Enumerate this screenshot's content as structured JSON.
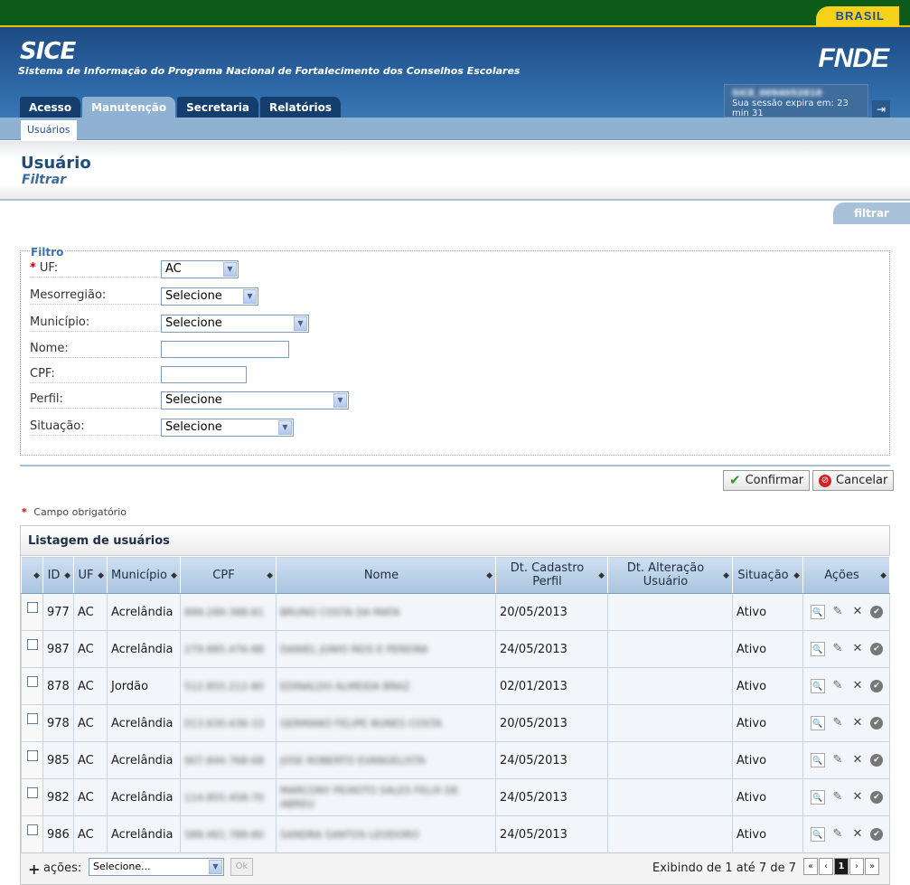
{
  "brasil_badge": "BRASIL",
  "app": {
    "title": "SICE",
    "subtitle": "Sistema de Informação do Programa Nacional de Fortalecimento dos Conselhos Escolares",
    "logo": "FNDE"
  },
  "session": {
    "user": "SICE_0094052816",
    "expires": "Sua sessão expira em: 23 min 31"
  },
  "tabs": [
    "Acesso",
    "Manutenção",
    "Secretaria",
    "Relatórios"
  ],
  "subtab": "Usuários",
  "page": {
    "title": "Usuário",
    "subtitle": "Filtrar",
    "filter_tab": "filtrar"
  },
  "filter": {
    "legend": "Filtro",
    "required_mark": "*",
    "uf_label": "UF:",
    "uf_value": "AC",
    "meso_label": "Mesorregião:",
    "meso_value": "Selecione",
    "mun_label": "Município:",
    "mun_value": "Selecione",
    "nome_label": "Nome:",
    "cpf_label": "CPF:",
    "perfil_label": "Perfil:",
    "perfil_value": "Selecione",
    "sit_label": "Situação:",
    "sit_value": "Selecione"
  },
  "buttons": {
    "confirm": "Confirmar",
    "cancel": "Cancelar"
  },
  "required_note": "Campo obrigatório",
  "list": {
    "title": "Listagem de usuários",
    "columns": [
      "",
      "ID",
      "UF",
      "Município",
      "CPF",
      "Nome",
      "Dt. Cadastro Perfil",
      "Dt. Alteração Usuário",
      "Situação",
      "Ações"
    ],
    "rows": [
      {
        "id": "977",
        "uf": "AC",
        "mun": "Acrelândia",
        "cpf": "899.289.388-81",
        "nome": "BRUNO COSTA DA MATA",
        "cad": "20/05/2013",
        "alt": "",
        "sit": "Ativo"
      },
      {
        "id": "987",
        "uf": "AC",
        "mun": "Acrelândia",
        "cpf": "279.885.476-88",
        "nome": "DANIEL JUNIO REIS E PEREIRA",
        "cad": "24/05/2013",
        "alt": "",
        "sit": "Ativo"
      },
      {
        "id": "878",
        "uf": "AC",
        "mun": "Jordão",
        "cpf": "512.855.212-80",
        "nome": "EDINALDO ALMEIDA BRAZ",
        "cad": "02/01/2013",
        "alt": "",
        "sit": "Ativo"
      },
      {
        "id": "978",
        "uf": "AC",
        "mun": "Acrelândia",
        "cpf": "013.630.436-33",
        "nome": "GERMANO FELIPE NUNES COSTA",
        "cad": "20/05/2013",
        "alt": "",
        "sit": "Ativo"
      },
      {
        "id": "985",
        "uf": "AC",
        "mun": "Acrelândia",
        "cpf": "907.844.768-68",
        "nome": "JOSE ROBERTO EVANGELISTA",
        "cad": "24/05/2013",
        "alt": "",
        "sit": "Ativo"
      },
      {
        "id": "982",
        "uf": "AC",
        "mun": "Acrelândia",
        "cpf": "114.855.458-70",
        "nome": "MARCONY PEIXOTO SALES FELIX DE ABREU",
        "cad": "24/05/2013",
        "alt": "",
        "sit": "Ativo"
      },
      {
        "id": "986",
        "uf": "AC",
        "mun": "Acrelândia",
        "cpf": "589.461.788-80",
        "nome": "SANDRA SANTOS LEODORO",
        "cad": "24/05/2013",
        "alt": "",
        "sit": "Ativo"
      }
    ]
  },
  "footer": {
    "plus": "+",
    "acoes_label": "ações:",
    "acoes_value": "Selecione...",
    "ok": "Ok",
    "paging": "Exibindo de 1 até 7 de 7",
    "pages": [
      "«",
      "‹",
      "1",
      "›",
      "»"
    ]
  }
}
